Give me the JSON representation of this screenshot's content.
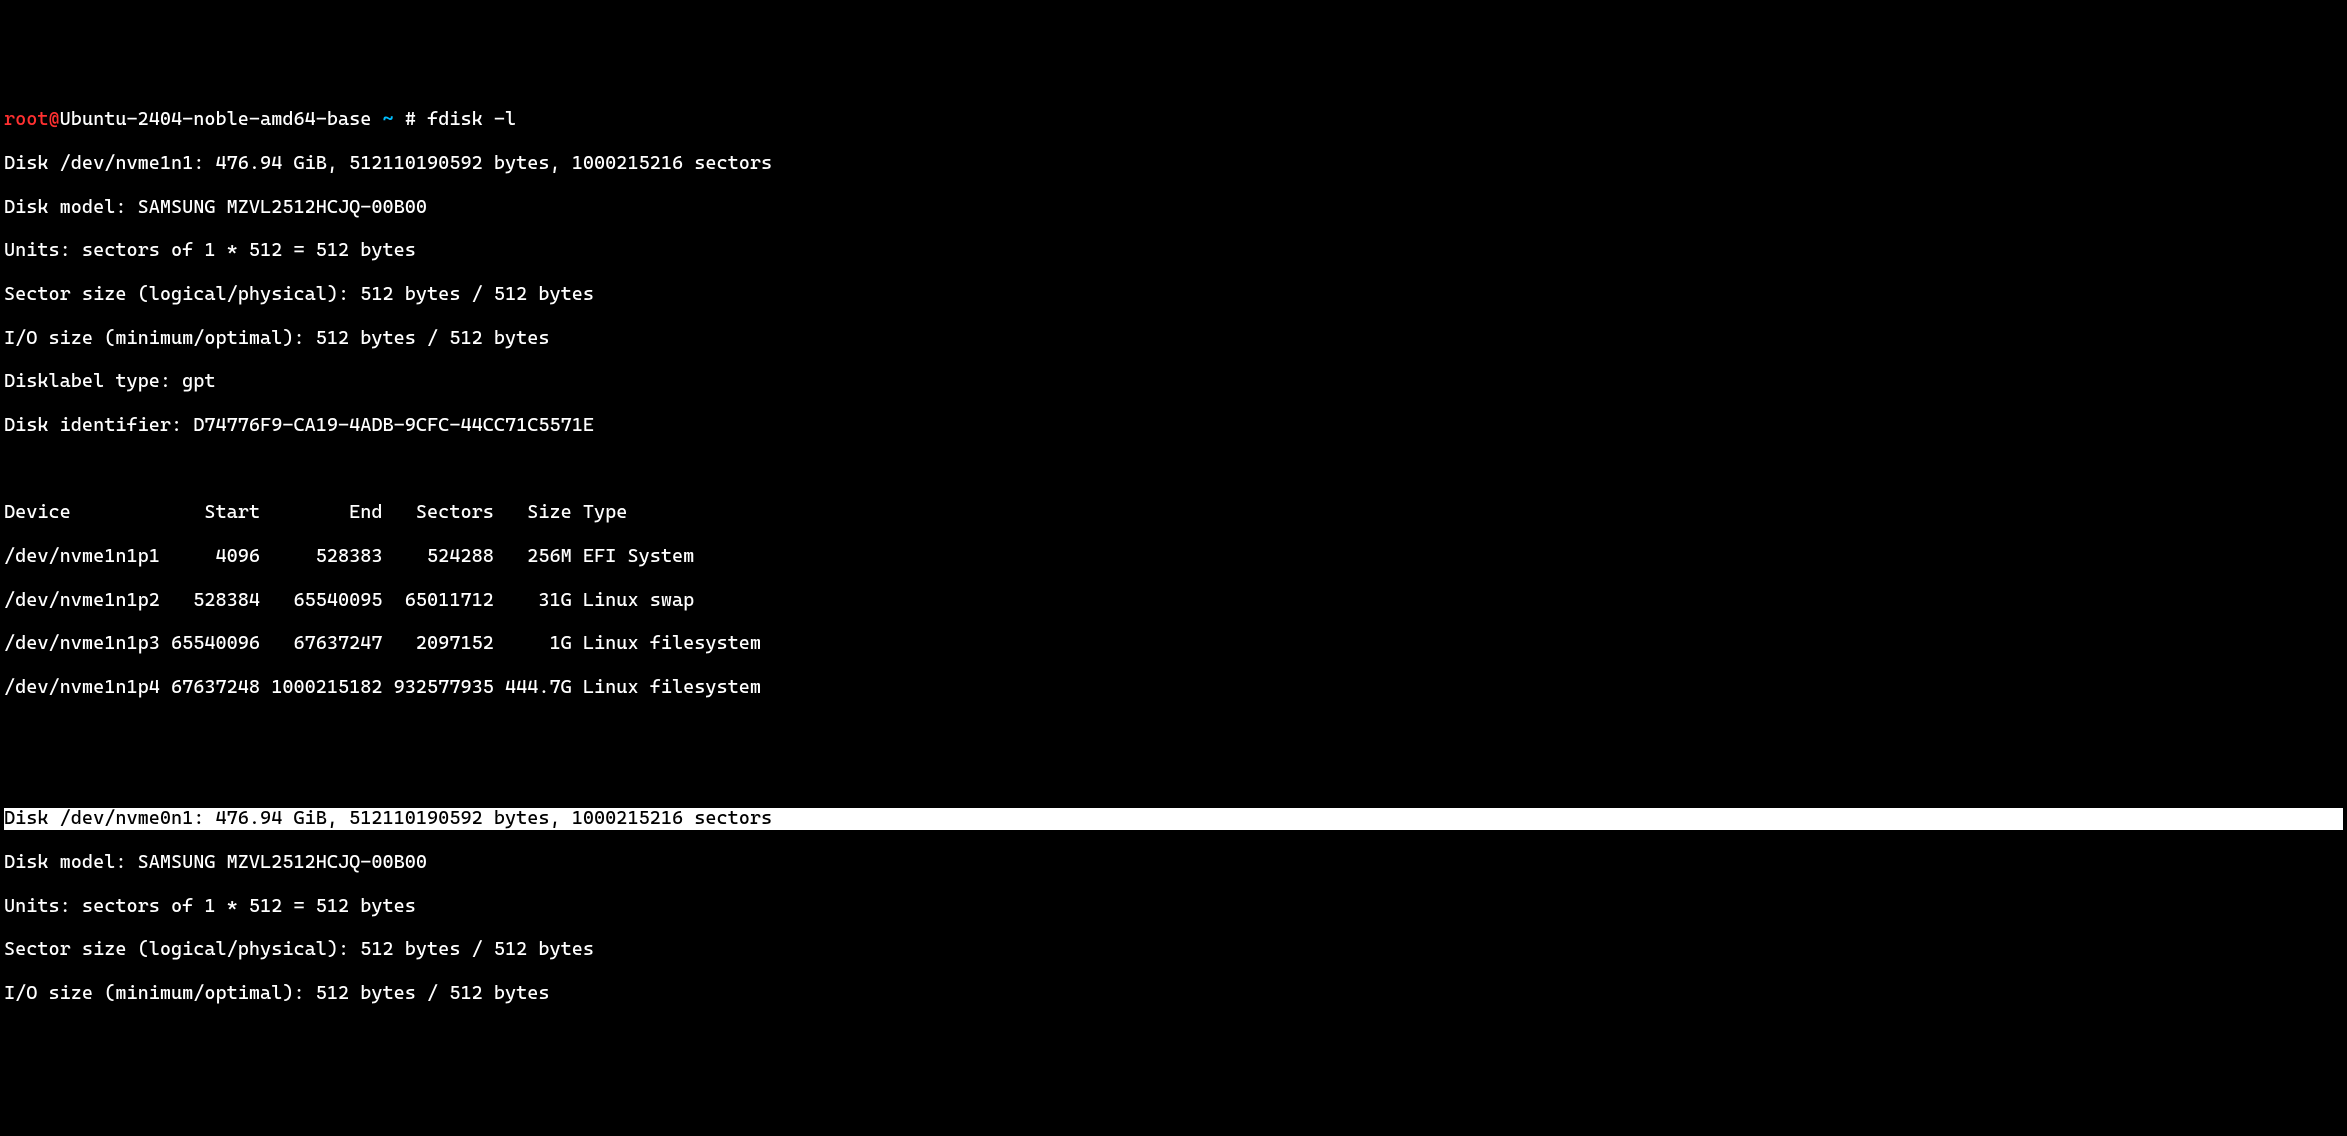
{
  "prompt": {
    "user": "root",
    "at": "@",
    "host": "Ubuntu-2404-noble-amd64-base",
    "path": "~",
    "hash": "#",
    "command": "fdisk -l"
  },
  "disk1": {
    "header": "Disk /dev/nvme1n1: 476.94 GiB, 512110190592 bytes, 1000215216 sectors",
    "model": "Disk model: SAMSUNG MZVL2512HCJQ-00B00",
    "units": "Units: sectors of 1 * 512 = 512 bytes",
    "sector_size": "Sector size (logical/physical): 512 bytes / 512 bytes",
    "io_size": "I/O size (minimum/optimal): 512 bytes / 512 bytes",
    "disklabel": "Disklabel type: gpt",
    "identifier": "Disk identifier: D74776F9-CA19-4ADB-9CFC-44CC71C5571E"
  },
  "table_header": "Device            Start        End   Sectors   Size Type",
  "partitions": [
    "/dev/nvme1n1p1     4096     528383    524288   256M EFI System",
    "/dev/nvme1n1p2   528384   65540095  65011712    31G Linux swap",
    "/dev/nvme1n1p3 65540096   67637247   2097152     1G Linux filesystem",
    "/dev/nvme1n1p4 67637248 1000215182 932577935 444.7G Linux filesystem"
  ],
  "disk2": {
    "header": "Disk /dev/nvme0n1: 476.94 GiB, 512110190592 bytes, 1000215216 sectors",
    "model": "Disk model: SAMSUNG MZVL2512HCJQ-00B00",
    "units": "Units: sectors of 1 * 512 = 512 bytes",
    "sector_size": "Sector size (logical/physical): 512 bytes / 512 bytes",
    "io_size": "I/O size (minimum/optimal): 512 bytes / 512 bytes"
  }
}
